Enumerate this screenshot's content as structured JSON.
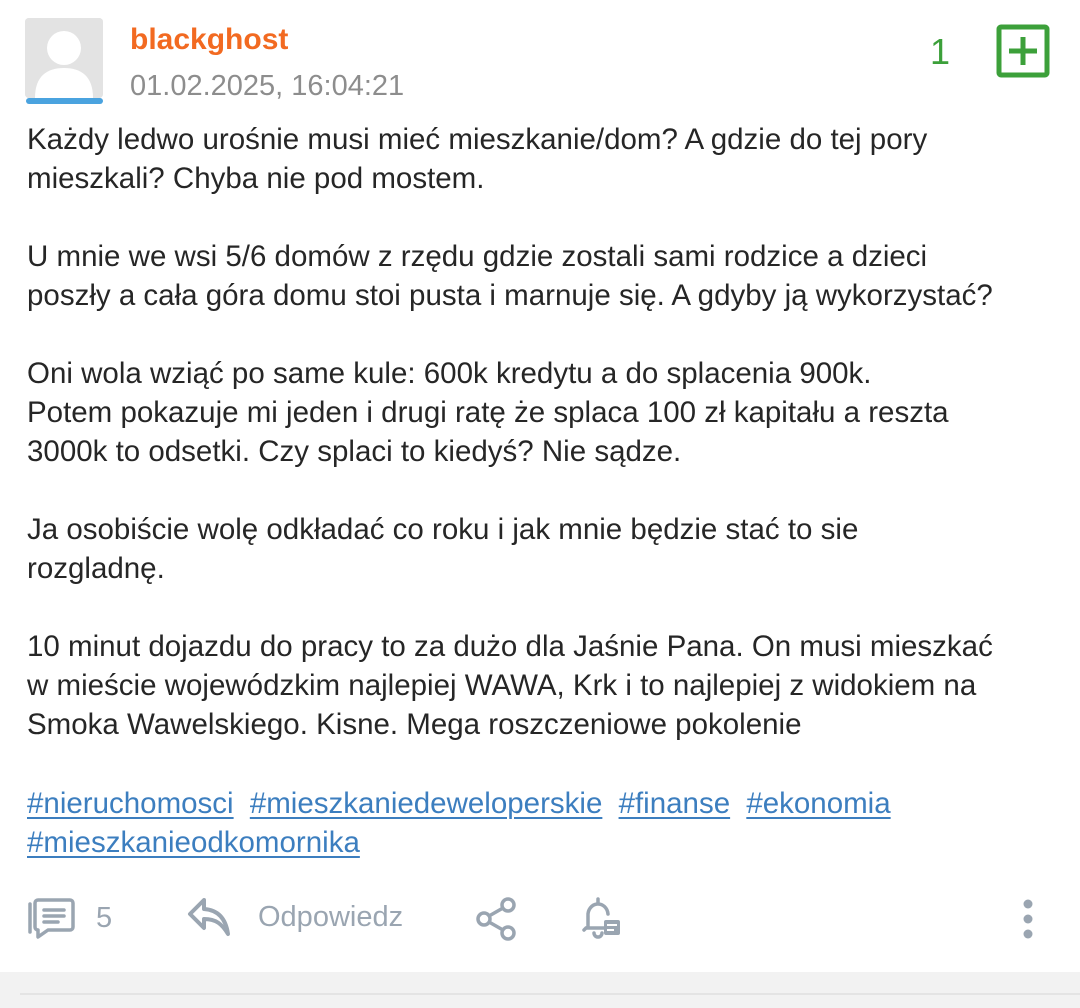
{
  "post": {
    "author": "blackghost",
    "timestamp": "01.02.2025, 16:04:21",
    "votes": "1",
    "paragraphs": [
      [
        "Każdy ledwo urośnie musi mieć mieszkanie/dom? A gdzie do tej pory",
        "mieszkali? Chyba nie pod mostem."
      ],
      [
        "U mnie we wsi 5/6 domów z rzędu gdzie zostali sami rodzice a dzieci",
        "poszły a cała góra domu stoi pusta i marnuje się. A gdyby ją wykorzystać?"
      ],
      [
        "Oni wola wziąć po same kule: 600k kredytu a do splacenia 900k.",
        "Potem pokazuje mi jeden i drugi ratę że splaca 100 zł kapitału a reszta",
        "3000k to odsetki. Czy splaci to kiedyś? Nie sądze."
      ],
      [
        "Ja osobiście wolę odkładać co roku i jak mnie będzie stać to sie",
        "rozgladnę."
      ],
      [
        "10 minut dojazdu do pracy to za dużo dla Jaśnie Pana. On musi mieszkać",
        "w mieście wojewódzkim najlepiej WAWA, Krk i to najlepiej z widokiem na",
        "Smoka Wawelskiego. Kisne. Mega roszczeniowe pokolenie"
      ]
    ],
    "tags": [
      "#nieruchomosci",
      "#mieszkaniedeweloperskie",
      "#finanse",
      "#ekonomia",
      "#mieszkanieodkomornika"
    ]
  },
  "toolbar": {
    "comments_count": "5",
    "reply_label": "Odpowiedz",
    "icons": [
      "comments-icon",
      "reply-icon",
      "share-icon",
      "notification-bell-icon",
      "more-options-icon"
    ]
  },
  "colors": {
    "author": "#f26a21",
    "vote": "#3ca03a",
    "tag": "#3c7ebf",
    "toolbar": "#9aa5b1",
    "avatar_bar": "#4aa3df"
  }
}
